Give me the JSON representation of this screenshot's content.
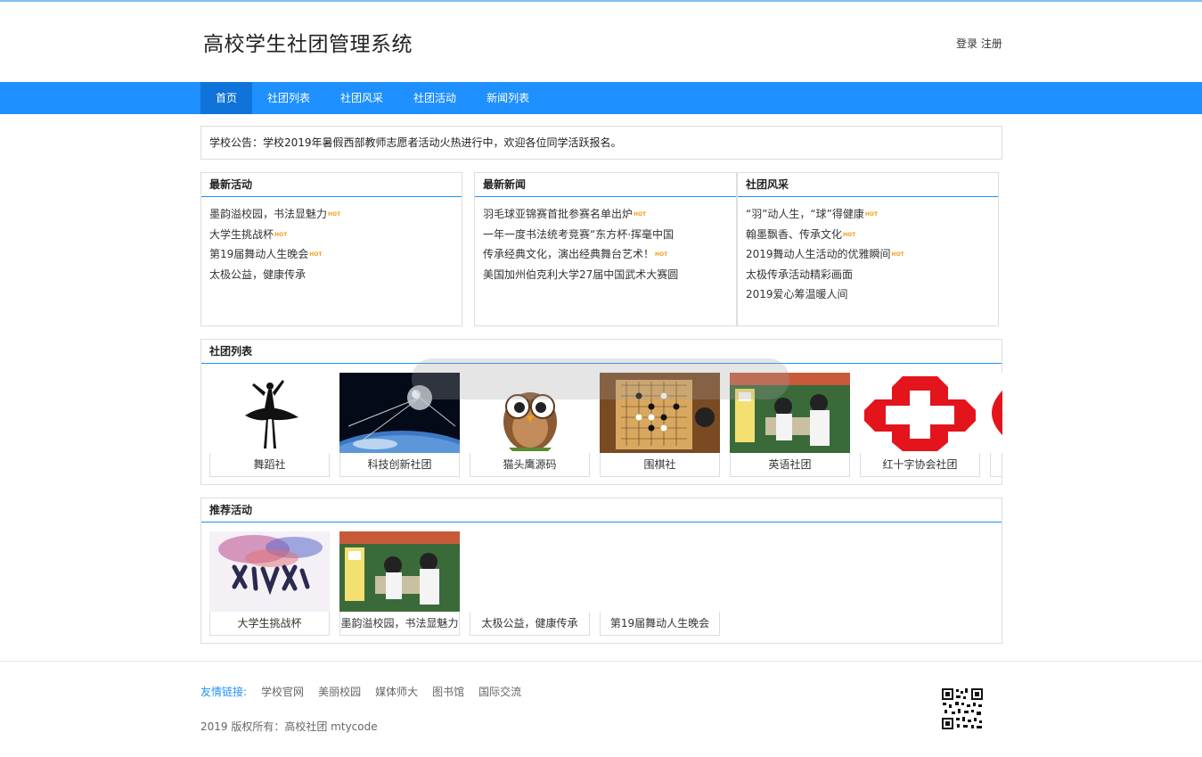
{
  "site": {
    "title": "高校学生社团管理系统",
    "login": "登录",
    "register": "注册"
  },
  "nav": [
    {
      "label": "首页",
      "active": true
    },
    {
      "label": "社团列表"
    },
    {
      "label": "社团风采"
    },
    {
      "label": "社团活动"
    },
    {
      "label": "新闻列表"
    }
  ],
  "notice": "学校公告：学校2019年暑假西部教师志愿者活动火热进行中，欢迎各位同学活跃报名。",
  "hot_badge": "HOT",
  "latest_activities": {
    "title": "最新活动",
    "items": [
      {
        "text": "墨韵溢校园，书法显魅力",
        "hot": true
      },
      {
        "text": "大学生挑战杯",
        "hot": true
      },
      {
        "text": "第19届舞动人生晚会",
        "hot": true
      },
      {
        "text": "太极公益，健康传承",
        "hot": false
      }
    ]
  },
  "latest_news": {
    "title": "最新新闻",
    "items": [
      {
        "text": "羽毛球亚锦赛首批参赛名单出炉",
        "hot": true
      },
      {
        "text": "一年一度书法统考竞赛“东方杯·挥毫中国",
        "hot": false
      },
      {
        "text": "传承经典文化，演出经典舞台艺术！",
        "hot": true
      },
      {
        "text": "美国加州伯克利大学27届中国武术大赛圆",
        "hot": false
      }
    ]
  },
  "club_style": {
    "title": "社团风采",
    "items": [
      {
        "text": "“羽”动人生，“球”得健康",
        "hot": true
      },
      {
        "text": "翰墨飘香、传承文化",
        "hot": true
      },
      {
        "text": "2019舞动人生活动的优雅瞬间",
        "hot": true
      },
      {
        "text": "太极传承活动精彩画面",
        "hot": false
      },
      {
        "text": "2019爱心筹温暖人间",
        "hot": false
      }
    ]
  },
  "club_list": {
    "title": "社团列表",
    "items": [
      {
        "name": "舞蹈社",
        "icon": "ballet-dancer-image"
      },
      {
        "name": "科技创新社团",
        "icon": "satellite-image"
      },
      {
        "name": "猫头鹰源码",
        "icon": "owl-image"
      },
      {
        "name": "围棋社",
        "icon": "go-board-image"
      },
      {
        "name": "英语社团",
        "icon": "classroom-image"
      },
      {
        "name": "红十字协会社团",
        "icon": "red-cross-image"
      },
      {
        "name": "",
        "icon": "red-cross-image"
      }
    ]
  },
  "recommended": {
    "title": "推荐活动",
    "items": [
      {
        "name": "大学生挑战杯",
        "icon": "challenge-cup-image"
      },
      {
        "name": "墨韵溢校园，书法显魅力",
        "icon": "classroom-image"
      },
      {
        "name": "太极公益，健康传承",
        "icon": ""
      },
      {
        "name": "第19届舞动人生晚会",
        "icon": ""
      }
    ]
  },
  "footer": {
    "links_label": "友情链接:",
    "links": [
      "学校官网",
      "美丽校园",
      "媒体师大",
      "图书馆",
      "国际交流"
    ],
    "copyright": "2019 版权所有：高校社团 mtycode"
  },
  "colors": {
    "accent": "#1e90ff",
    "nav_active": "#0f73d9",
    "hot": "#f0a020"
  }
}
